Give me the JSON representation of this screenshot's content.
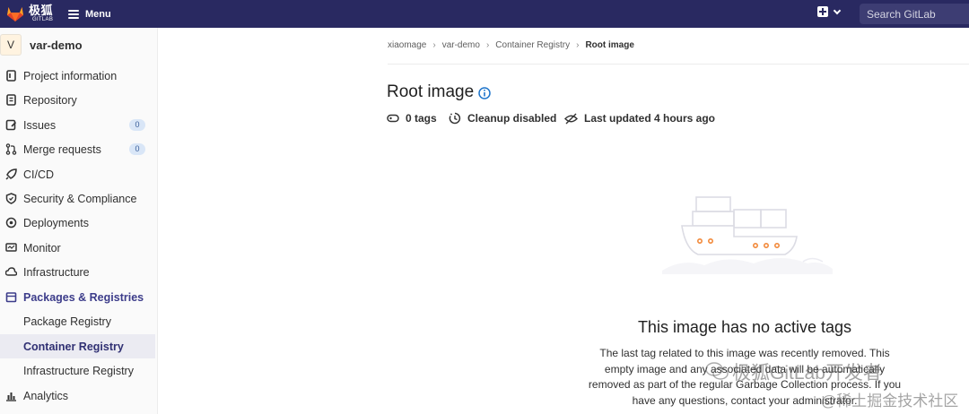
{
  "header": {
    "brand_cn": "极狐",
    "brand_en": "GITLAB",
    "menu_label": "Menu",
    "search_placeholder": "Search GitLab"
  },
  "sidebar": {
    "project_avatar": "V",
    "project_name": "var-demo",
    "items": [
      {
        "label": "Project information",
        "icon": "info-doc-icon"
      },
      {
        "label": "Repository",
        "icon": "doc-icon"
      },
      {
        "label": "Issues",
        "icon": "issues-icon",
        "badge": "0"
      },
      {
        "label": "Merge requests",
        "icon": "merge-request-icon",
        "badge": "0"
      },
      {
        "label": "CI/CD",
        "icon": "rocket-icon"
      },
      {
        "label": "Security & Compliance",
        "icon": "shield-icon"
      },
      {
        "label": "Deployments",
        "icon": "deployments-icon"
      },
      {
        "label": "Monitor",
        "icon": "monitor-icon"
      },
      {
        "label": "Infrastructure",
        "icon": "cloud-gear-icon"
      },
      {
        "label": "Packages & Registries",
        "icon": "package-icon"
      },
      {
        "label": "Package Registry"
      },
      {
        "label": "Container Registry"
      },
      {
        "label": "Infrastructure Registry"
      },
      {
        "label": "Analytics",
        "icon": "chart-icon"
      }
    ]
  },
  "breadcrumb": [
    "xiaomage",
    "var-demo",
    "Container Registry",
    "Root image"
  ],
  "page": {
    "title": "Root image",
    "tags": "0 tags",
    "cleanup": "Cleanup disabled",
    "updated": "Last updated 4 hours ago"
  },
  "empty_state": {
    "title": "This image has no active tags",
    "line1": "The last tag related to this image was recently removed. This",
    "line2": "empty image and any associated data will be automatically",
    "line3": "removed as part of the regular Garbage Collection process. If you",
    "line4": "have any questions, contact your administrator."
  },
  "watermark": {
    "line1": "极狐GitLab开发者",
    "line2": "@稀土掘金技术社区"
  },
  "colors": {
    "topbar": "#292961",
    "active_nav": "#303073",
    "badge_bg": "#d9e6f7",
    "info_blue": "#1f75cb"
  }
}
